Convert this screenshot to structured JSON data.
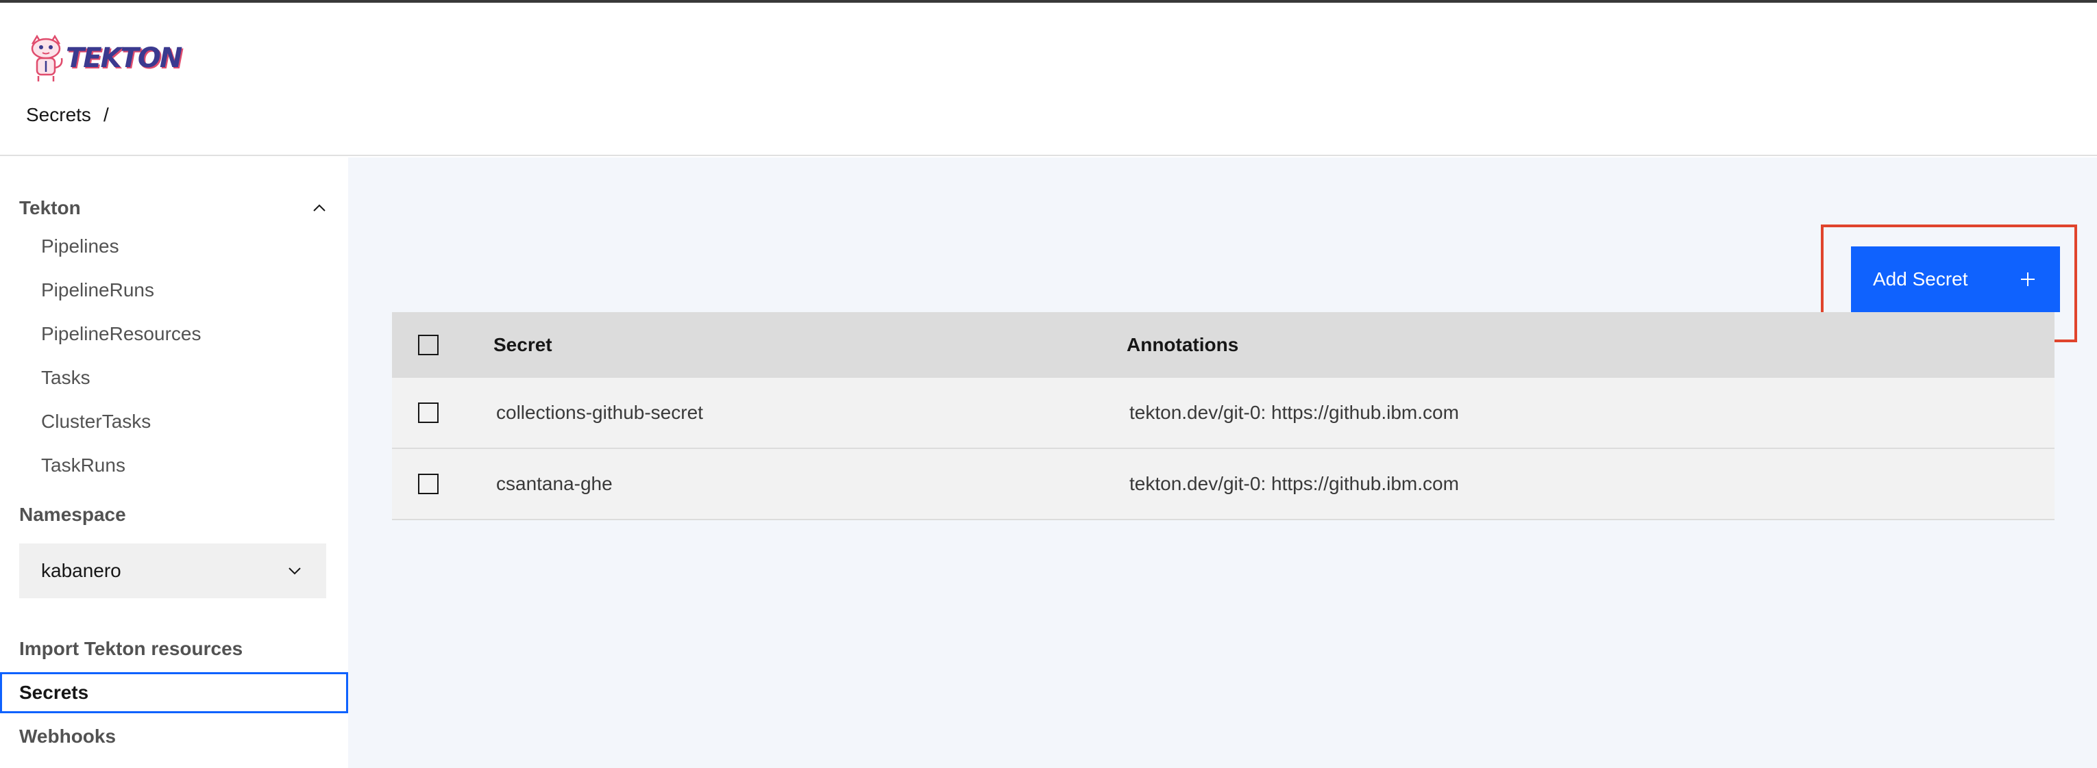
{
  "app": {
    "logo_text": "TEKTON"
  },
  "breadcrumb": {
    "current": "Secrets",
    "separator": "/"
  },
  "sidebar": {
    "section_title": "Tekton",
    "items": [
      {
        "label": "Pipelines"
      },
      {
        "label": "PipelineRuns"
      },
      {
        "label": "PipelineResources"
      },
      {
        "label": "Tasks"
      },
      {
        "label": "ClusterTasks"
      },
      {
        "label": "TaskRuns"
      }
    ],
    "namespace_label": "Namespace",
    "namespace_value": "kabanero",
    "import_label": "Import Tekton resources",
    "secrets_label": "Secrets",
    "webhooks_label": "Webhooks"
  },
  "toolbar": {
    "add_label": "Add Secret",
    "add_icon": "plus-icon"
  },
  "table": {
    "columns": [
      "Secret",
      "Annotations"
    ],
    "rows": [
      {
        "secret": "collections-github-secret",
        "annotations": "tekton.dev/git-0: https://github.ibm.com"
      },
      {
        "secret": "csantana-ghe",
        "annotations": "tekton.dev/git-0: https://github.ibm.com"
      }
    ]
  },
  "colors": {
    "accent": "#0f62fe",
    "highlight": "#e0442c",
    "main_bg": "#f3f6fb"
  }
}
